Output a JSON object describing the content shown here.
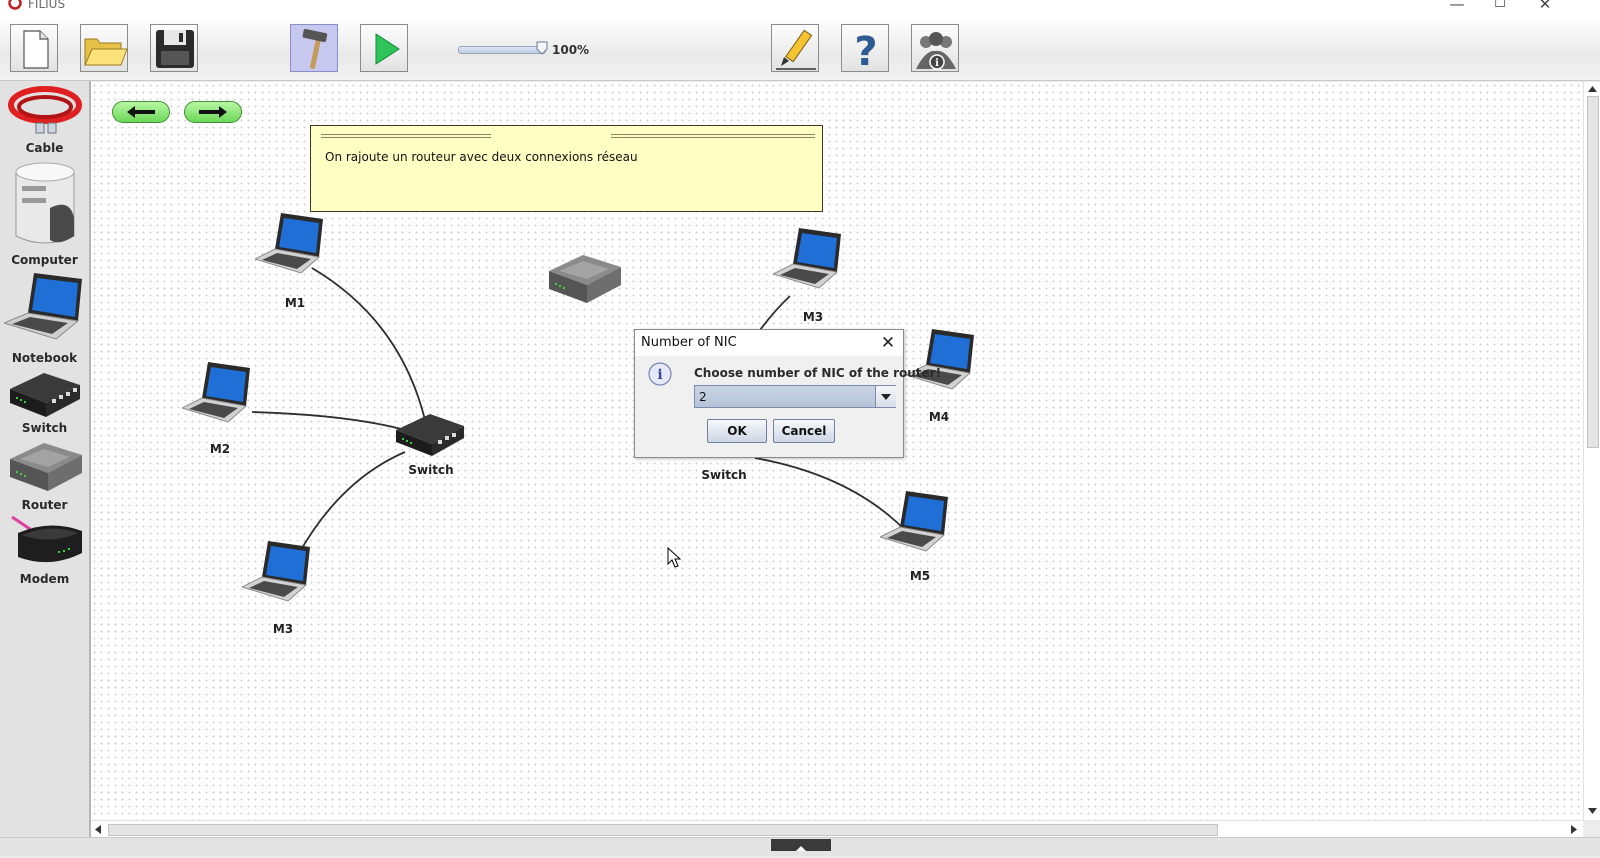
{
  "window": {
    "title": "FILIUS",
    "minimize": "—",
    "maximize": "☐",
    "close": "✕"
  },
  "toolbar": {
    "buttons": [
      "new-file",
      "open-folder",
      "save",
      "design-mode-hammer",
      "simulation-play",
      "documentation-pencil",
      "help",
      "about-info"
    ],
    "zoom_value": 1.0,
    "zoom_label": "100%"
  },
  "palette": {
    "items": [
      {
        "label": "Cable"
      },
      {
        "label": "Computer"
      },
      {
        "label": "Notebook"
      },
      {
        "label": "Switch"
      },
      {
        "label": "Router"
      },
      {
        "label": "Modem"
      }
    ]
  },
  "note": {
    "text": "On rajoute un routeur avec deux connexions réseau"
  },
  "nodes": {
    "m1": "M1",
    "m2": "M2",
    "m3_left": "M3",
    "switch_left": "Switch",
    "m3_right": "M3",
    "m4": "M4",
    "switch_right": "Switch",
    "m5": "M5"
  },
  "dialog": {
    "title": "Number of NIC",
    "close": "✕",
    "message": "Choose number of NIC of the router!",
    "selected_value": "2",
    "ok_label": "OK",
    "cancel_label": "Cancel"
  },
  "colors": {
    "note_background": "#ffffc4",
    "active_tool": "#c6c8ef",
    "nav_green": "#6cd858",
    "cable_red": "#e02020"
  }
}
